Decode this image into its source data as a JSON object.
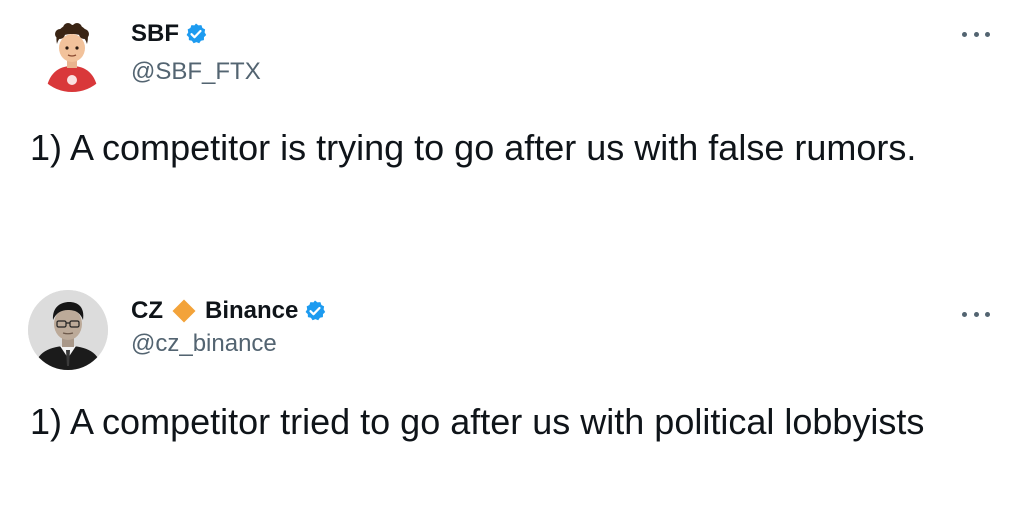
{
  "tweets": [
    {
      "display_name": "SBF",
      "handle": "@SBF_FTX",
      "verified": true,
      "text": "1) A competitor is trying to go after us with false rumors.",
      "avatar_icon": "cartoon-avatar-icon"
    },
    {
      "display_name_part1": "CZ",
      "display_name_part2": "Binance",
      "handle": "@cz_binance",
      "verified": true,
      "text": "1) A competitor tried to go after us with political lobbyists",
      "avatar_icon": "photo-avatar-icon"
    }
  ],
  "colors": {
    "verified_blue": "#1d9bf0",
    "binance_diamond": "#f3a33a",
    "handle_gray": "#536471",
    "text_black": "#0f1419"
  },
  "icons": {
    "verified": "verified-badge-icon",
    "binance": "binance-diamond-icon",
    "more": "more-options-icon"
  }
}
